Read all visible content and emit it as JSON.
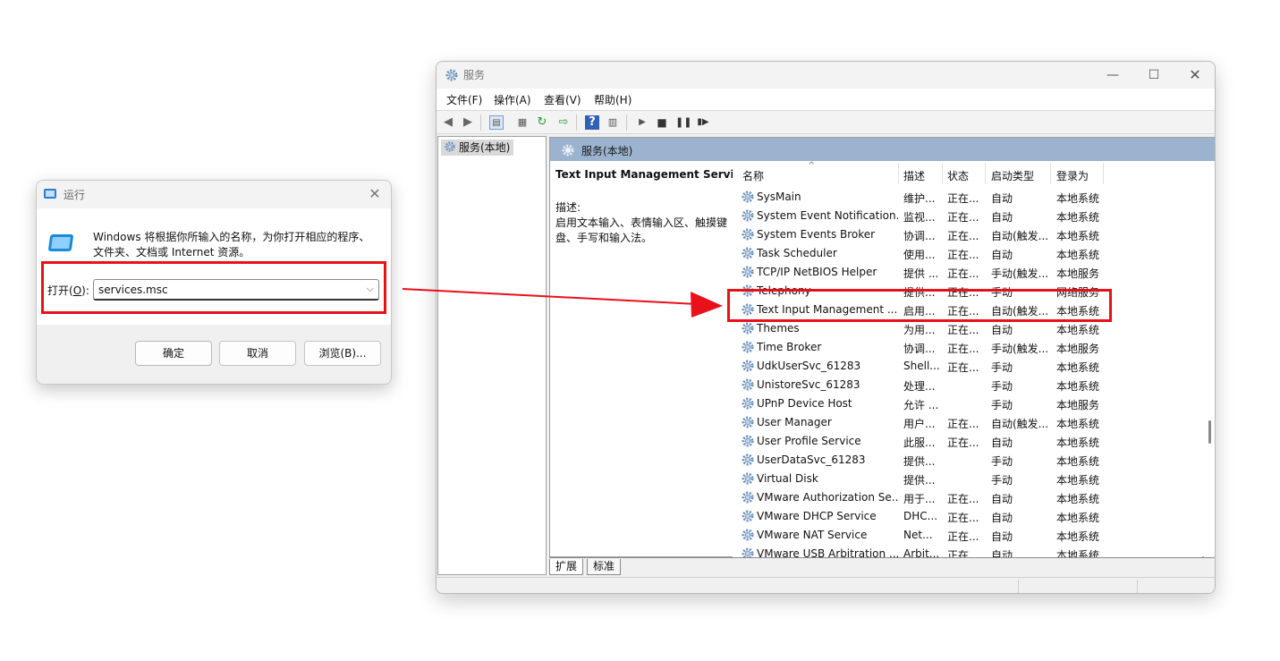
{
  "run_dialog": {
    "title": "运行",
    "description": "Windows 将根据你所输入的名称，为你打开相应的程序、文件夹、文档或 Internet 资源。",
    "open_label_prefix": "打开(",
    "open_label_key": "O",
    "open_label_suffix": "):",
    "input_value": "services.msc",
    "buttons": {
      "ok": "确定",
      "cancel": "取消",
      "browse": "浏览(B)..."
    }
  },
  "services_window": {
    "title": "服务",
    "menu": [
      "文件(F)",
      "操作(A)",
      "查看(V)",
      "帮助(H)"
    ],
    "tree_item": "服务(本地)",
    "pane_header": "服务(本地)",
    "detail": {
      "name": "Text Input Management Service",
      "desc_label": "描述:",
      "desc_text": "启用文本输入、表情输入区、触摸键盘、手写和输入法。"
    },
    "columns": [
      "名称",
      "描述",
      "状态",
      "启动类型",
      "登录为"
    ],
    "rows": [
      {
        "name": "SysMain",
        "desc": "维护...",
        "state": "正在...",
        "start": "自动",
        "logon": "本地系统"
      },
      {
        "name": "System Event Notification...",
        "desc": "监视...",
        "state": "正在...",
        "start": "自动",
        "logon": "本地系统"
      },
      {
        "name": "System Events Broker",
        "desc": "协调...",
        "state": "正在...",
        "start": "自动(触发...",
        "logon": "本地系统"
      },
      {
        "name": "Task Scheduler",
        "desc": "使用...",
        "state": "正在...",
        "start": "自动",
        "logon": "本地系统"
      },
      {
        "name": "TCP/IP NetBIOS Helper",
        "desc": "提供 ...",
        "state": "正在...",
        "start": "手动(触发...",
        "logon": "本地服务"
      },
      {
        "name": "Telephony",
        "desc": "提供...",
        "state": "正在...",
        "start": "手动",
        "logon": "网络服务"
      },
      {
        "name": "Text Input Management ...",
        "desc": "启用...",
        "state": "正在...",
        "start": "自动(触发...",
        "logon": "本地系统"
      },
      {
        "name": "Themes",
        "desc": "为用...",
        "state": "正在...",
        "start": "自动",
        "logon": "本地系统"
      },
      {
        "name": "Time Broker",
        "desc": "协调...",
        "state": "正在...",
        "start": "手动(触发...",
        "logon": "本地服务"
      },
      {
        "name": "UdkUserSvc_61283",
        "desc": "Shell...",
        "state": "正在...",
        "start": "手动",
        "logon": "本地系统"
      },
      {
        "name": "UnistoreSvc_61283",
        "desc": "处理...",
        "state": "",
        "start": "手动",
        "logon": "本地系统"
      },
      {
        "name": "UPnP Device Host",
        "desc": "允许 ...",
        "state": "",
        "start": "手动",
        "logon": "本地服务"
      },
      {
        "name": "User Manager",
        "desc": "用户...",
        "state": "正在...",
        "start": "自动(触发...",
        "logon": "本地系统"
      },
      {
        "name": "User Profile Service",
        "desc": "此服...",
        "state": "正在...",
        "start": "自动",
        "logon": "本地系统"
      },
      {
        "name": "UserDataSvc_61283",
        "desc": "提供...",
        "state": "",
        "start": "手动",
        "logon": "本地系统"
      },
      {
        "name": "Virtual Disk",
        "desc": "提供...",
        "state": "",
        "start": "手动",
        "logon": "本地系统"
      },
      {
        "name": "VMware Authorization Se...",
        "desc": "用于...",
        "state": "正在...",
        "start": "自动",
        "logon": "本地系统"
      },
      {
        "name": "VMware DHCP Service",
        "desc": "DHC...",
        "state": "正在...",
        "start": "自动",
        "logon": "本地系统"
      },
      {
        "name": "VMware NAT Service",
        "desc": "Net...",
        "state": "正在...",
        "start": "自动",
        "logon": "本地系统"
      },
      {
        "name": "VMware USB Arbitration ...",
        "desc": "Arbit...",
        "state": "正在...",
        "start": "自动",
        "logon": "本地系统"
      }
    ],
    "tabs": [
      "扩展",
      "标准"
    ]
  },
  "colors": {
    "highlight": "#e8111a",
    "pane_header": "#9bb3cf"
  }
}
